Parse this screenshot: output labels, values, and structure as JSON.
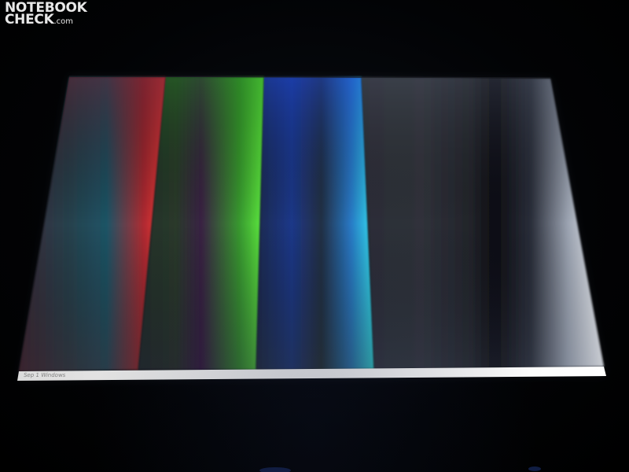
{
  "watermark": {
    "line1": "NOTEBOOK",
    "line2": "CHECK",
    "suffix": ".com"
  },
  "taskbar": {
    "text": "Sep 1 Windows"
  },
  "bands": [
    {
      "name": "red",
      "colors": {
        "dark": "#3a2030",
        "mid": "#1e5a66",
        "bright": "#ff3a3a"
      }
    },
    {
      "name": "green",
      "colors": {
        "dark": "#1e2a24",
        "mid": "#3a1e4a",
        "bright": "#5cff3a"
      }
    },
    {
      "name": "blue",
      "colors": {
        "dark": "#1a2a66",
        "mid": "#2a3a20",
        "bright": "#30e8ff"
      }
    },
    {
      "name": "gray",
      "colors": {
        "dark": "#2a2c34",
        "mid": "#0a0a10",
        "bright": "#f4f6fa"
      }
    }
  ]
}
